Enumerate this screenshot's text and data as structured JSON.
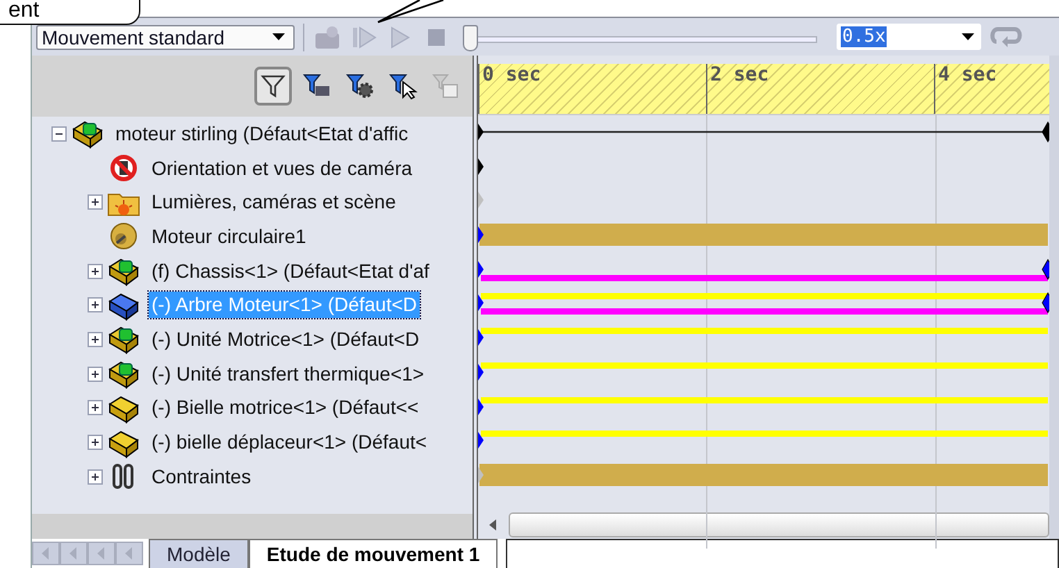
{
  "callout": {
    "text": "ent"
  },
  "toolbar": {
    "study_type": "Mouvement standard",
    "controls": [
      {
        "kind": "calculate",
        "disabled": true
      },
      {
        "kind": "play_from_start",
        "disabled": true
      },
      {
        "kind": "play",
        "disabled": true
      },
      {
        "kind": "stop",
        "disabled": true
      }
    ],
    "slider": {
      "level": 0
    },
    "speed": "0.5x",
    "loop": {
      "disabled": true
    }
  },
  "filters": [
    {
      "kind": "filter",
      "selected": true
    },
    {
      "kind": "camera",
      "selected": false
    },
    {
      "kind": "gear",
      "selected": false
    },
    {
      "kind": "cursor",
      "selected": false
    },
    {
      "kind": "result",
      "selected": false
    }
  ],
  "ruler": [
    "0 sec",
    "2 sec",
    "4 sec"
  ],
  "tree": [
    {
      "label": "moteur stirling  (Défaut<Etat d'affic",
      "kind": "assembly",
      "expanded": true,
      "selected": false,
      "track": {
        "kind": "line",
        "start_key": {
          "color": "#000000"
        },
        "end_key": {
          "color": "#000000"
        }
      },
      "children": [
        {
          "label": "Orientation et vues de caméra",
          "kind": "orientation",
          "selected": false,
          "track": {
            "kind": "key",
            "start_key": {
              "color": "#000000"
            }
          }
        },
        {
          "label": "Lumières, caméras et scène",
          "kind": "lights",
          "expanded": false,
          "selected": false,
          "track": {
            "kind": "key",
            "start_key": {
              "color": "#c0c0c0"
            }
          }
        },
        {
          "label": "Moteur circulaire1",
          "kind": "motor",
          "selected": false,
          "track": {
            "kind": "band",
            "color": "#d0ad4c",
            "start_key": {
              "color": "#0000ff"
            }
          }
        },
        {
          "label": "(f) Chassis<1>  (Défaut<Etat d'af",
          "kind": "assembly",
          "expanded": false,
          "selected": false,
          "track": {
            "kind": "stripes",
            "stripes": [
              {
                "kind": "lower",
                "color": "#ff00ff"
              }
            ],
            "start_key": {
              "color": "#0000ff"
            },
            "end_key": {
              "color": "#0000ff"
            }
          }
        },
        {
          "label": "(-) Arbre Moteur<1> (Défaut<D",
          "kind": "part_blue",
          "expanded": false,
          "selected": true,
          "track": {
            "kind": "stripes",
            "stripes": [
              {
                "kind": "upper",
                "color": "#ffff00"
              },
              {
                "kind": "lower",
                "color": "#ff00ff"
              }
            ],
            "start_key": {
              "color": "#0000ff"
            },
            "end_key": {
              "color": "#0000ff"
            }
          }
        },
        {
          "label": "(-) Unité Motrice<1>  (Défaut<D",
          "kind": "assembly",
          "expanded": false,
          "selected": false,
          "track": {
            "kind": "stripes",
            "stripes": [
              {
                "kind": "upper",
                "color": "#ffff00"
              }
            ],
            "start_key": {
              "color": "#0000ff"
            }
          }
        },
        {
          "label": "(-) Unité transfert thermique<1>",
          "kind": "assembly",
          "expanded": false,
          "selected": false,
          "track": {
            "kind": "stripes",
            "stripes": [
              {
                "kind": "upper",
                "color": "#ffff00"
              }
            ],
            "start_key": {
              "color": "#0000ff"
            }
          }
        },
        {
          "label": "(-) Bielle  motrice<1>  (Défaut<<",
          "kind": "part",
          "expanded": false,
          "selected": false,
          "track": {
            "kind": "stripes",
            "stripes": [
              {
                "kind": "upper",
                "color": "#ffff00"
              }
            ],
            "start_key": {
              "color": "#0000ff"
            }
          }
        },
        {
          "label": "(-) bielle déplaceur<1>  (Défaut<",
          "kind": "part",
          "expanded": false,
          "selected": false,
          "track": {
            "kind": "stripes",
            "stripes": [
              {
                "kind": "upper",
                "color": "#ffff00"
              }
            ],
            "start_key": {
              "color": "#0000ff"
            }
          }
        },
        {
          "label": "Contraintes",
          "kind": "mates",
          "expanded": false,
          "selected": false,
          "track": {
            "kind": "band",
            "color": "#d0ad4c",
            "start_key": {
              "color": "#c0c0c0"
            }
          }
        }
      ]
    }
  ],
  "tabs": [
    {
      "label": "Modèle",
      "selected": false
    },
    {
      "label": "Etude de mouvement 1",
      "selected": true
    }
  ]
}
